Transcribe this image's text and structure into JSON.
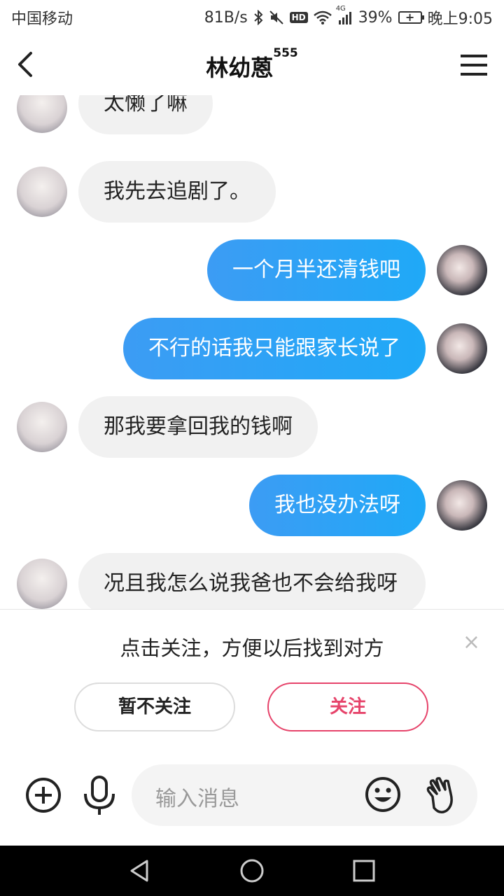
{
  "status_bar": {
    "carrier": "中国移动",
    "speed": "81B/s",
    "hd": "HD",
    "network": "4G",
    "battery": "39%",
    "time": "晚上9:05"
  },
  "header": {
    "title": "林幼蒽",
    "title_sup": "555"
  },
  "messages": [
    {
      "side": "other",
      "text": "太懒了嘛"
    },
    {
      "side": "other",
      "text": "我先去追剧了。"
    },
    {
      "side": "me",
      "text": "一个月半还清钱吧"
    },
    {
      "side": "me",
      "text": "不行的话我只能跟家长说了"
    },
    {
      "side": "other",
      "text": "那我要拿回我的钱啊"
    },
    {
      "side": "me",
      "text": "我也没办法呀"
    },
    {
      "side": "other",
      "text": "况且我怎么说我爸也不会给我呀"
    }
  ],
  "follow_prompt": {
    "text": "点击关注，方便以后找到对方",
    "close": "×",
    "decline_label": "暂不关注",
    "follow_label": "关注"
  },
  "input": {
    "placeholder": "输入消息"
  },
  "colors": {
    "my_bubble": "#1fa9f7",
    "other_bubble": "#f1f1f1",
    "follow_accent": "#e6436a"
  }
}
